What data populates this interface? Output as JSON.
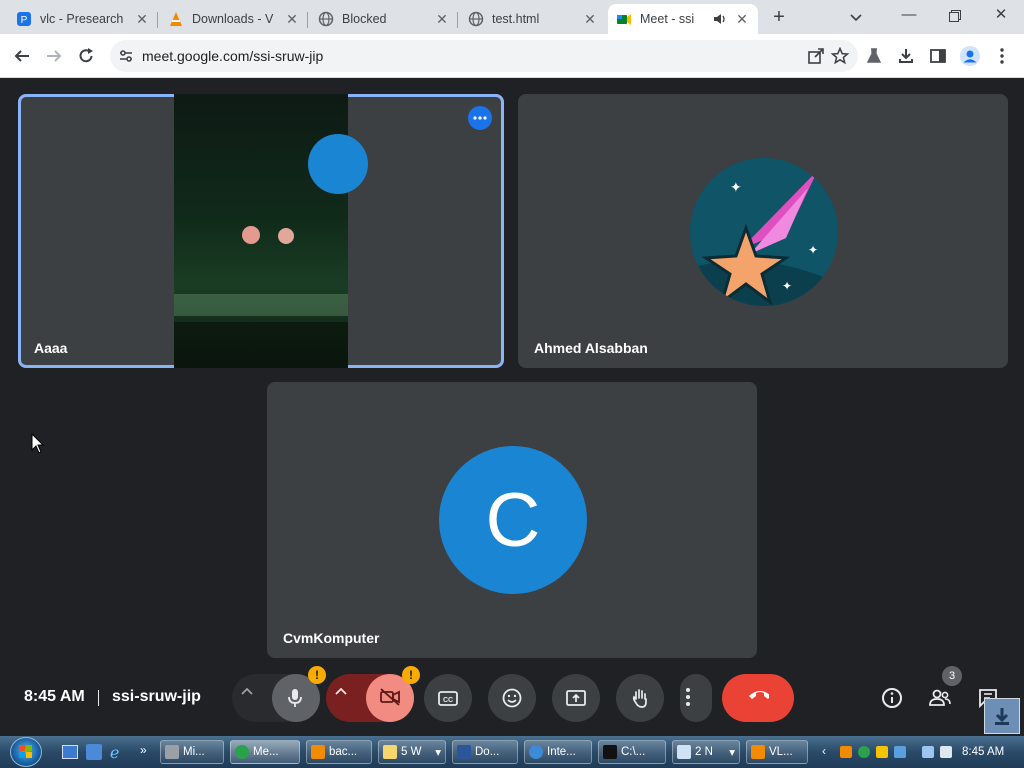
{
  "browser": {
    "tabs": [
      {
        "title": "vlc - Presearch",
        "icon": "presearch-icon"
      },
      {
        "title": "Downloads - V",
        "icon": "vlc-cone-icon"
      },
      {
        "title": "Blocked",
        "icon": "globe-icon"
      },
      {
        "title": "test.html",
        "icon": "globe-icon"
      },
      {
        "title": "Meet - ssi",
        "icon": "meet-icon",
        "active": true
      }
    ],
    "url": "meet.google.com/ssi-sruw-jip"
  },
  "meet": {
    "participants": [
      {
        "name": "Aaaa",
        "speaking": true
      },
      {
        "name": "Ahmed Alsabban"
      },
      {
        "name": "CvmKomputer",
        "initial": "C"
      }
    ],
    "time": "8:45 AM",
    "meeting_code": "ssi-sruw-jip",
    "people_count": "3",
    "warning_mark": "!"
  },
  "taskbar": {
    "items": [
      "Mi...",
      "Me...",
      "bac...",
      "5 W",
      "Do...",
      "Inte...",
      "C:\\...",
      "2 N",
      "VL..."
    ],
    "clock": "8:45 AM"
  },
  "colors": {
    "meet_bg": "#202124",
    "tile_bg": "#3c4043",
    "end_call": "#ea4335",
    "speaking_outline": "#8ab4f8",
    "avatar_blue": "#1a85d3"
  }
}
